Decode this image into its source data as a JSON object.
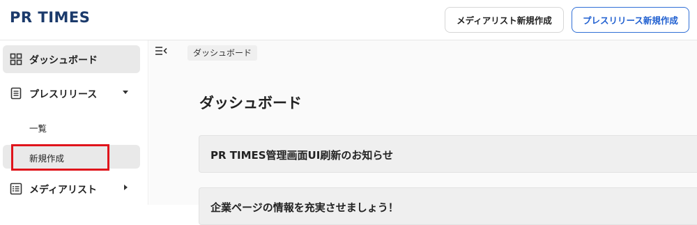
{
  "header": {
    "logo": "PR TIMES",
    "media_list_button": "メディアリスト新規作成",
    "press_release_button": "プレスリリース新規作成"
  },
  "sidebar": {
    "items": [
      {
        "label": "ダッシュボード",
        "icon": "dashboard-icon",
        "active": true
      },
      {
        "label": "プレスリリース",
        "icon": "document-icon",
        "expanded": true
      },
      {
        "label": "メディアリスト",
        "icon": "list-icon",
        "expanded": false
      }
    ],
    "press_release_sub": [
      {
        "label": "一覧"
      },
      {
        "label": "新規作成",
        "active": true
      }
    ]
  },
  "main": {
    "breadcrumb": "ダッシュボード",
    "title": "ダッシュボード",
    "notices": [
      {
        "text": "PR TIMES管理画面UI刷新のお知らせ"
      },
      {
        "text": "企業ページの情報を充実させましょう！"
      }
    ]
  },
  "colors": {
    "brand": "#1b3a6b",
    "accent": "#2f6fd6",
    "highlight": "#e0141b"
  }
}
